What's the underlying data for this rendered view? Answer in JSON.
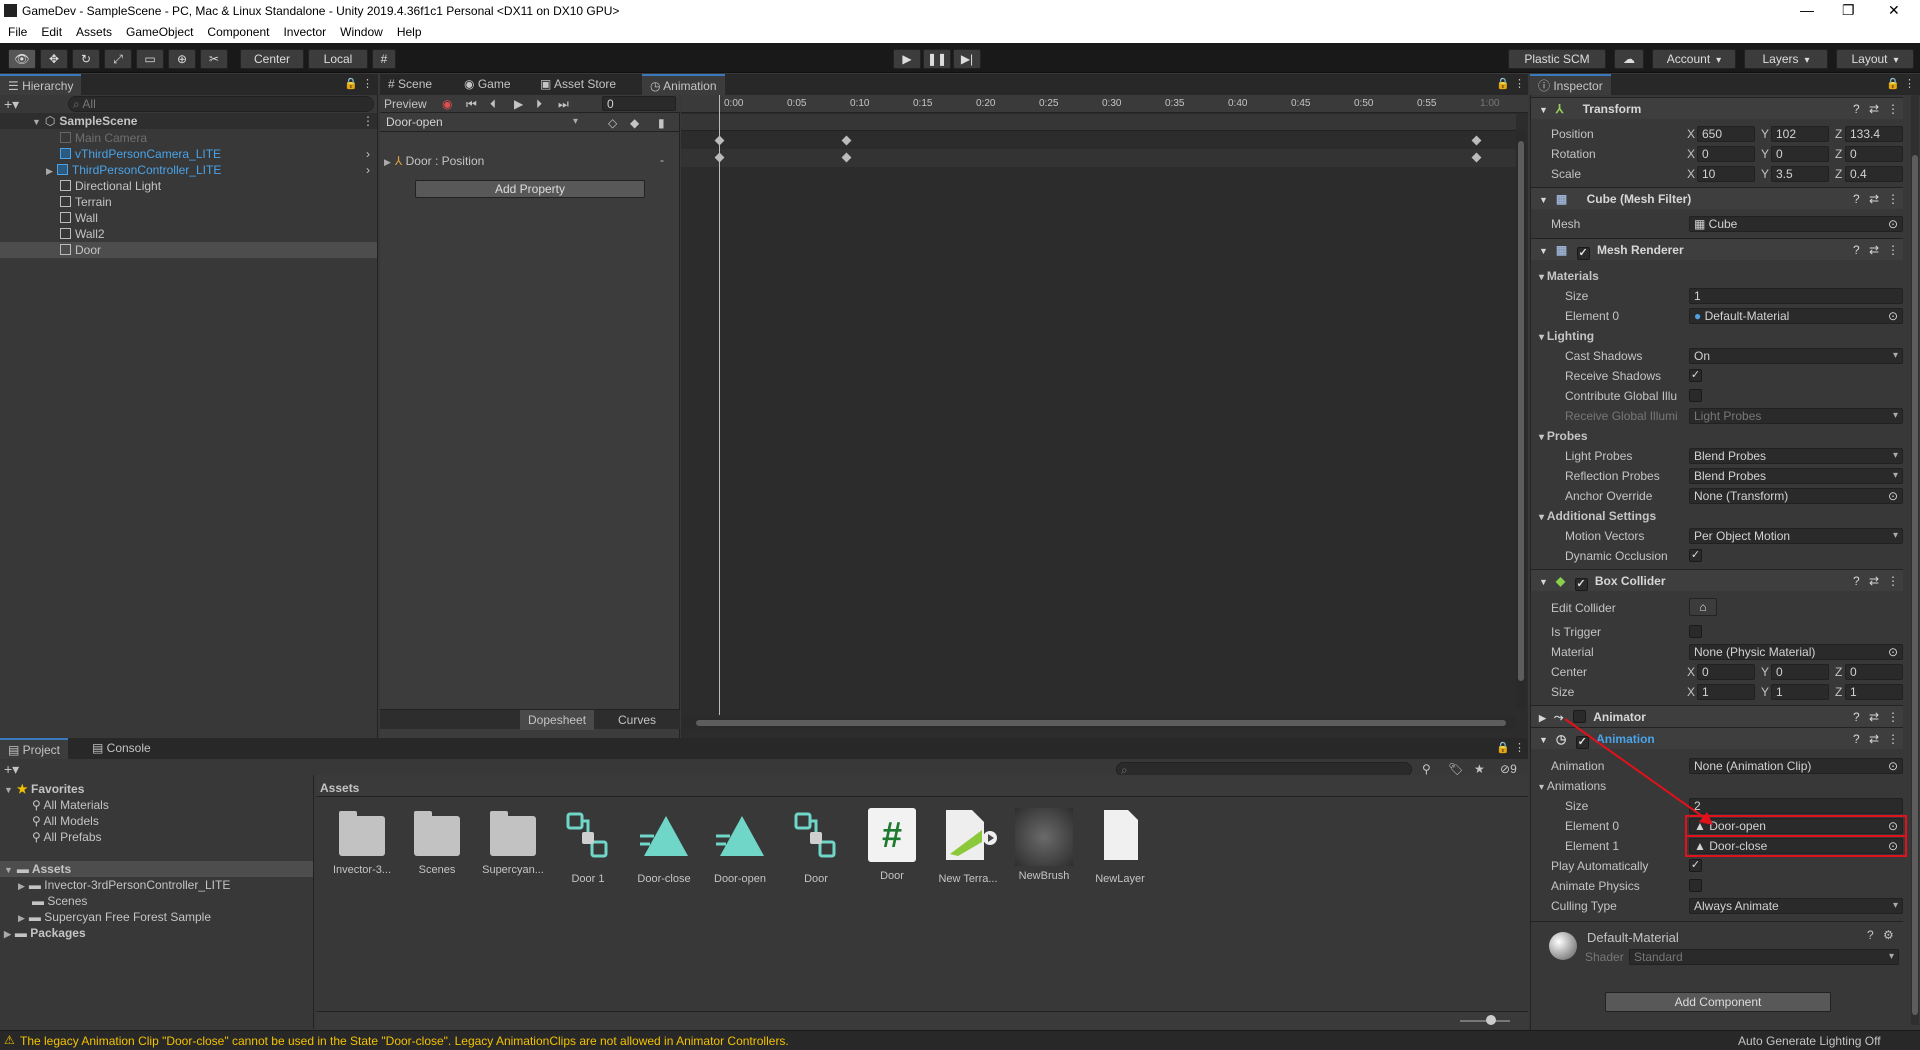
{
  "window": {
    "title": "GameDev - SampleScene - PC, Mac & Linux Standalone - Unity 2019.4.36f1c1 Personal <DX11 on DX10 GPU>",
    "minimize": "—",
    "maximize": "❐",
    "close": "✕"
  },
  "menu": [
    "File",
    "Edit",
    "Assets",
    "GameObject",
    "Component",
    "Invector",
    "Window",
    "Help"
  ],
  "toolbar": {
    "pivot": "Center",
    "space": "Local",
    "plastic": "Plastic SCM",
    "account": "Account",
    "layers": "Layers",
    "layout": "Layout"
  },
  "hierarchy": {
    "tab": "Hierarchy",
    "search_placeholder": "All",
    "scene": "SampleScene",
    "items": [
      "Main Camera",
      "vThirdPersonCamera_LITE",
      "ThirdPersonController_LITE",
      "Directional Light",
      "Terrain",
      "Wall",
      "Wall2",
      "Door"
    ]
  },
  "center_tabs": [
    "Scene",
    "Game",
    "Asset Store",
    "Animation"
  ],
  "animation": {
    "preview": "Preview",
    "frame": "0",
    "clip": "Door-open",
    "property": "Door : Position",
    "add_property": "Add Property",
    "ruler": [
      "0:00",
      "0:05",
      "0:10",
      "0:15",
      "0:20",
      "0:25",
      "0:30",
      "0:35",
      "0:40",
      "0:45",
      "0:50",
      "0:55",
      "1:00"
    ],
    "bottom_tabs": [
      "Dopesheet",
      "Curves"
    ]
  },
  "inspector": {
    "tab": "Inspector",
    "transform": {
      "title": "Transform",
      "position": {
        "label": "Position",
        "x": "650",
        "y": "102",
        "z": "133.4"
      },
      "rotation": {
        "label": "Rotation",
        "x": "0",
        "y": "0",
        "z": "0"
      },
      "scale": {
        "label": "Scale",
        "x": "10",
        "y": "3.5",
        "z": "0.4"
      }
    },
    "mesh_filter": {
      "title": "Cube (Mesh Filter)",
      "mesh_label": "Mesh",
      "mesh": "Cube"
    },
    "mesh_renderer": {
      "title": "Mesh Renderer",
      "materials": "Materials",
      "size_label": "Size",
      "size": "1",
      "element0_label": "Element 0",
      "element0": "Default-Material",
      "lighting": "Lighting",
      "cast_shadows_label": "Cast Shadows",
      "cast_shadows": "On",
      "receive_shadows": "Receive Shadows",
      "contribute_gi": "Contribute Global Illu",
      "receive_gi": "Receive Global Illumi",
      "receive_gi_value": "Light Probes",
      "probes": "Probes",
      "light_probes_label": "Light Probes",
      "light_probes": "Blend Probes",
      "reflection_probes_label": "Reflection Probes",
      "reflection_probes": "Blend Probes",
      "anchor_override_label": "Anchor Override",
      "anchor_override": "None (Transform)",
      "additional": "Additional Settings",
      "motion_vectors_label": "Motion Vectors",
      "motion_vectors": "Per Object Motion",
      "dynamic_occlusion": "Dynamic Occlusion"
    },
    "box_collider": {
      "title": "Box Collider",
      "edit_collider": "Edit Collider",
      "is_trigger": "Is Trigger",
      "material_label": "Material",
      "material": "None (Physic Material)",
      "center": {
        "label": "Center",
        "x": "0",
        "y": "0",
        "z": "0"
      },
      "size": {
        "label": "Size",
        "x": "1",
        "y": "1",
        "z": "1"
      }
    },
    "animator": {
      "title": "Animator"
    },
    "animation": {
      "title": "Animation",
      "animation_label": "Animation",
      "animation": "None (Animation Clip)",
      "animations": "Animations",
      "size_label": "Size",
      "size": "2",
      "element0_label": "Element 0",
      "element0": "Door-open",
      "element1_label": "Element 1",
      "element1": "Door-close",
      "play_auto": "Play Automatically",
      "animate_physics": "Animate Physics",
      "culling_label": "Culling Type",
      "culling": "Always Animate"
    },
    "material": {
      "name": "Default-Material",
      "shader_label": "Shader",
      "shader": "Standard"
    },
    "add_component": "Add Component"
  },
  "project": {
    "tabs": [
      "Project",
      "Console"
    ],
    "favorites": "Favorites",
    "fav_items": [
      "All Materials",
      "All Models",
      "All Prefabs"
    ],
    "assets": "Assets",
    "asset_folders": [
      "Invector-3rdPersonController_LITE",
      "Scenes",
      "Supercyan Free Forest Sample"
    ],
    "packages": "Packages",
    "hidden_count": "9",
    "grid_title": "Assets",
    "grid": [
      "Invector-3...",
      "Scenes",
      "Supercyan...",
      "Door 1",
      "Door-close",
      "Door-open",
      "Door",
      "Door",
      "New Terra...",
      "NewBrush",
      "NewLayer"
    ]
  },
  "status": {
    "warning": "The legacy Animation Clip \"Door-close\" cannot be used in the State \"Door-close\". Legacy AnimationClips are not allowed in Animator Controllers.",
    "right": "Auto Generate Lighting Off"
  },
  "colors": {
    "accent": "#3a79bb",
    "highlight": "#e0111a",
    "warning": "#f2c200"
  }
}
